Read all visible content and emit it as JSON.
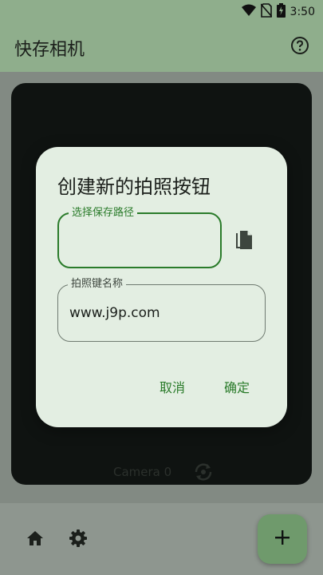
{
  "status_bar": {
    "time": "3:50",
    "icons": [
      "wifi-icon",
      "no-sim-icon",
      "battery-charging-icon"
    ]
  },
  "app_bar": {
    "title": "快存相机",
    "help_icon": "help-circle-icon"
  },
  "camera": {
    "label": "Camera 0",
    "switch_icon": "switch-camera-icon"
  },
  "dialog": {
    "title": "创建新的拍照按钮",
    "save_path": {
      "label": "选择保存路径",
      "value": ""
    },
    "paste_icon": "paste-icon",
    "key_name": {
      "label": "拍照键名称",
      "value": "www.j9p.com"
    },
    "cancel_label": "取消",
    "ok_label": "确定"
  },
  "bottom_bar": {
    "home_icon": "home-icon",
    "settings_icon": "settings-icon",
    "fab_icon": "add-icon"
  },
  "colors": {
    "accent": "#2a7b2a",
    "app_bar": "#8fae8c",
    "dialog_bg": "#e3eee2",
    "camera_bg": "#0f1311",
    "fab": "#6f9a6c"
  }
}
